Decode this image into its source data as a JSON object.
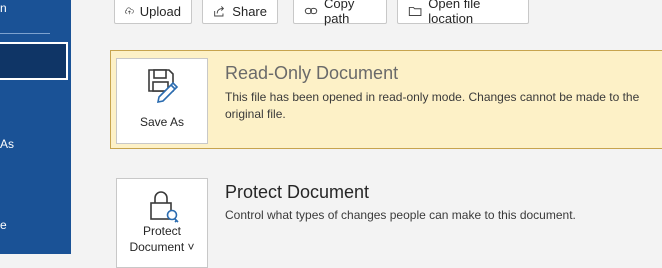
{
  "sidebar": {
    "top_text": "n",
    "item_as": "As",
    "item_e": "e"
  },
  "toolbar": {
    "upload": "Upload",
    "share": "Share",
    "copy_path": "Copy path",
    "open_location": "Open file location"
  },
  "readonly": {
    "tile_label": "Save As",
    "title": "Read-Only Document",
    "description": "This file has been opened in read-only mode. Changes cannot be made to the original file."
  },
  "protect": {
    "tile_label_line1": "Protect",
    "tile_label_line2": "Document ˅",
    "title": "Protect Document",
    "description": "Control what types of changes people can make to this document."
  },
  "colors": {
    "sidebar": "#1a5296",
    "banner": "#fdf1c7",
    "banner_border": "#c7a44e"
  }
}
